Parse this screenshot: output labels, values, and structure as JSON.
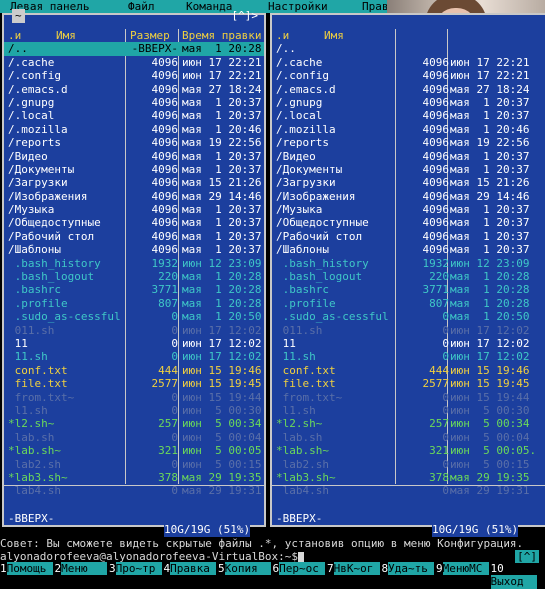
{
  "menu": [
    "Левая панель",
    "Файл",
    "Команда",
    "Настройки",
    "Правая панель"
  ],
  "left_panel": {
    "tab_label": "~",
    "top_right": "[^]>",
    "headers": {
      "n": ".и",
      "name": "Имя",
      "size": "Размер",
      "time": "Время правки"
    },
    "rows": [
      {
        "n": "/..",
        "size": "-ВВЕРХ-",
        "date": "мая  1 20:28",
        "c": "sel"
      },
      {
        "n": "/.cache",
        "size": "4096",
        "date": "июн 17 22:21",
        "c": ""
      },
      {
        "n": "/.config",
        "size": "4096",
        "date": "июн 17 22:21",
        "c": ""
      },
      {
        "n": "/.emacs.d",
        "size": "4096",
        "date": "мая 27 18:24",
        "c": ""
      },
      {
        "n": "/.gnupg",
        "size": "4096",
        "date": "мая  1 20:37",
        "c": ""
      },
      {
        "n": "/.local",
        "size": "4096",
        "date": "мая  1 20:37",
        "c": ""
      },
      {
        "n": "/.mozilla",
        "size": "4096",
        "date": "мая  1 20:46",
        "c": ""
      },
      {
        "n": "/reports",
        "size": "4096",
        "date": "мая 19 22:56",
        "c": ""
      },
      {
        "n": "/Видео",
        "size": "4096",
        "date": "мая  1 20:37",
        "c": ""
      },
      {
        "n": "/Документы",
        "size": "4096",
        "date": "мая  1 20:37",
        "c": ""
      },
      {
        "n": "/Загрузки",
        "size": "4096",
        "date": "мая 15 21:26",
        "c": ""
      },
      {
        "n": "/Изображения",
        "size": "4096",
        "date": "мая 29 14:46",
        "c": ""
      },
      {
        "n": "/Музыка",
        "size": "4096",
        "date": "мая  1 20:37",
        "c": ""
      },
      {
        "n": "/Общедоступные",
        "size": "4096",
        "date": "мая  1 20:37",
        "c": ""
      },
      {
        "n": "/Рабочий стол",
        "size": "4096",
        "date": "мая  1 20:37",
        "c": ""
      },
      {
        "n": "/Шаблоны",
        "size": "4096",
        "date": "мая  1 20:37",
        "c": ""
      },
      {
        "n": " .bash_history",
        "size": "1932",
        "date": "июн 12 23:09",
        "c": "cyan"
      },
      {
        "n": " .bash_logout",
        "size": "220",
        "date": "мая  1 20:28",
        "c": "cyan"
      },
      {
        "n": " .bashrc",
        "size": "3771",
        "date": "мая  1 20:28",
        "c": "cyan"
      },
      {
        "n": " .profile",
        "size": "807",
        "date": "мая  1 20:28",
        "c": "cyan"
      },
      {
        "n": " .sudo_as-cessful",
        "size": "0",
        "date": "мая  1 20:50",
        "c": "cyan"
      },
      {
        "n": " 011.sh",
        "size": "0",
        "date": "июн 17 12:02",
        "c": "dim"
      },
      {
        "n": " 11",
        "size": "0",
        "date": "июн 17 12:02",
        "c": ""
      },
      {
        "n": " 11.sh",
        "size": "0",
        "date": "июн 17 12:02",
        "c": "cyan"
      },
      {
        "n": " conf.txt",
        "size": "444",
        "date": "июн 15 19:46",
        "c": "yellow"
      },
      {
        "n": " file.txt",
        "size": "2577",
        "date": "июн 15 19:45",
        "c": "yellow"
      },
      {
        "n": " from.txt~",
        "size": "0",
        "date": "июн 15 19:44",
        "c": "dim"
      },
      {
        "n": " l1.sh",
        "size": "0",
        "date": "июн  5 00:30",
        "c": "dim"
      },
      {
        "n": "*l2.sh~",
        "size": "257",
        "date": "июн  5 00:34",
        "c": "green"
      },
      {
        "n": " lab.sh",
        "size": "0",
        "date": "июн  5 00:04",
        "c": "dim"
      },
      {
        "n": "*lab.sh~",
        "size": "321",
        "date": "июн  5 00:05",
        "c": "green"
      },
      {
        "n": " lab2.sh",
        "size": "0",
        "date": "июн  5 00:15",
        "c": "dim"
      },
      {
        "n": "*lab3.sh~",
        "size": "378",
        "date": "мая 29 19:35",
        "c": "green"
      },
      {
        "n": " lab4.sh",
        "size": "0",
        "date": "мая 29 19:31",
        "c": "dim"
      }
    ],
    "mini_status": "-ВВЕРХ-",
    "disk": "10G/19G (51%)"
  },
  "right_panel": {
    "headers": {
      "n": ".и",
      "name": "Имя"
    },
    "rows": [
      {
        "n": "/..",
        "size": "",
        "date": "",
        "c": ""
      },
      {
        "n": "/.cache",
        "size": "4096",
        "date": "июн 17 22:21",
        "c": ""
      },
      {
        "n": "/.config",
        "size": "4096",
        "date": "июн 17 22:21",
        "c": ""
      },
      {
        "n": "/.emacs.d",
        "size": "4096",
        "date": "мая 27 18:24",
        "c": ""
      },
      {
        "n": "/.gnupg",
        "size": "4096",
        "date": "мая  1 20:37",
        "c": ""
      },
      {
        "n": "/.local",
        "size": "4096",
        "date": "мая  1 20:37",
        "c": ""
      },
      {
        "n": "/.mozilla",
        "size": "4096",
        "date": "мая  1 20:46",
        "c": ""
      },
      {
        "n": "/reports",
        "size": "4096",
        "date": "мая 19 22:56",
        "c": ""
      },
      {
        "n": "/Видео",
        "size": "4096",
        "date": "мая  1 20:37",
        "c": ""
      },
      {
        "n": "/Документы",
        "size": "4096",
        "date": "мая  1 20:37",
        "c": ""
      },
      {
        "n": "/Загрузки",
        "size": "4096",
        "date": "мая 15 21:26",
        "c": ""
      },
      {
        "n": "/Изображения",
        "size": "4096",
        "date": "мая 29 14:46",
        "c": ""
      },
      {
        "n": "/Музыка",
        "size": "4096",
        "date": "мая  1 20:37",
        "c": ""
      },
      {
        "n": "/Общедоступные",
        "size": "4096",
        "date": "мая  1 20:37",
        "c": ""
      },
      {
        "n": "/Рабочий стол",
        "size": "4096",
        "date": "мая  1 20:37",
        "c": ""
      },
      {
        "n": "/Шаблоны",
        "size": "4096",
        "date": "мая  1 20:37",
        "c": ""
      },
      {
        "n": " .bash_history",
        "size": "1932",
        "date": "июн 12 23:09",
        "c": "cyan"
      },
      {
        "n": " .bash_logout",
        "size": "220",
        "date": "мая  1 20:28",
        "c": "cyan"
      },
      {
        "n": " .bashrc",
        "size": "3771",
        "date": "мая  1 20:28",
        "c": "cyan"
      },
      {
        "n": " .profile",
        "size": "807",
        "date": "мая  1 20:28",
        "c": "cyan"
      },
      {
        "n": " .sudo_as-cessful",
        "size": "0",
        "date": "мая  1 20:50",
        "c": "cyan"
      },
      {
        "n": " 011.sh",
        "size": "0",
        "date": "июн 17 12:02",
        "c": "dim"
      },
      {
        "n": " 11",
        "size": "0",
        "date": "июн 17 12:02",
        "c": ""
      },
      {
        "n": " 11.sh",
        "size": "0",
        "date": "июн 17 12:02",
        "c": "cyan"
      },
      {
        "n": " conf.txt",
        "size": "444",
        "date": "июн 15 19:46",
        "c": "yellow"
      },
      {
        "n": " file.txt",
        "size": "2577",
        "date": "июн 15 19:45",
        "c": "yellow"
      },
      {
        "n": " from.txt~",
        "size": "0",
        "date": "июн 15 19:44",
        "c": "dim"
      },
      {
        "n": " l1.sh",
        "size": "0",
        "date": "июн  5 00:30",
        "c": "dim"
      },
      {
        "n": "*l2.sh~",
        "size": "257",
        "date": "июн  5 00:34",
        "c": "green"
      },
      {
        "n": " lab.sh",
        "size": "0",
        "date": "июн  5 00:04",
        "c": "dim"
      },
      {
        "n": "*lab.sh~",
        "size": "321",
        "date": "июн  5 00:05.",
        "c": "green"
      },
      {
        "n": " lab2.sh",
        "size": "0",
        "date": "июн  5 00:15",
        "c": "dim"
      },
      {
        "n": "*lab3.sh~",
        "size": "378",
        "date": "мая 29 19:35",
        "c": "green"
      },
      {
        "n": " lab4.sh",
        "size": "0",
        "date": "мая 29 19:31",
        "c": "dim"
      }
    ],
    "mini_status": "-ВВЕРХ-",
    "disk": "10G/19G (51%)"
  },
  "hint": "Совет: Вы сможете видеть скрытые файлы .*, установив опцию в меню Конфигурация.",
  "prompt": "alyonadorofeeva@alyonadorofeeva-VirtualBox:~$",
  "caret_label": "[^]",
  "fkeys": [
    {
      "n": "1",
      "l": "Помощь"
    },
    {
      "n": "2",
      "l": "Меню"
    },
    {
      "n": "3",
      "l": "Про~тр"
    },
    {
      "n": "4",
      "l": "Правка"
    },
    {
      "n": "5",
      "l": "Копия"
    },
    {
      "n": "6",
      "l": "Пер~ос"
    },
    {
      "n": "7",
      "l": "НвК~ог"
    },
    {
      "n": "8",
      "l": "Уда~ть"
    },
    {
      "n": "9",
      "l": "МенюМС"
    },
    {
      "n": "10",
      "l": "Выход"
    }
  ]
}
